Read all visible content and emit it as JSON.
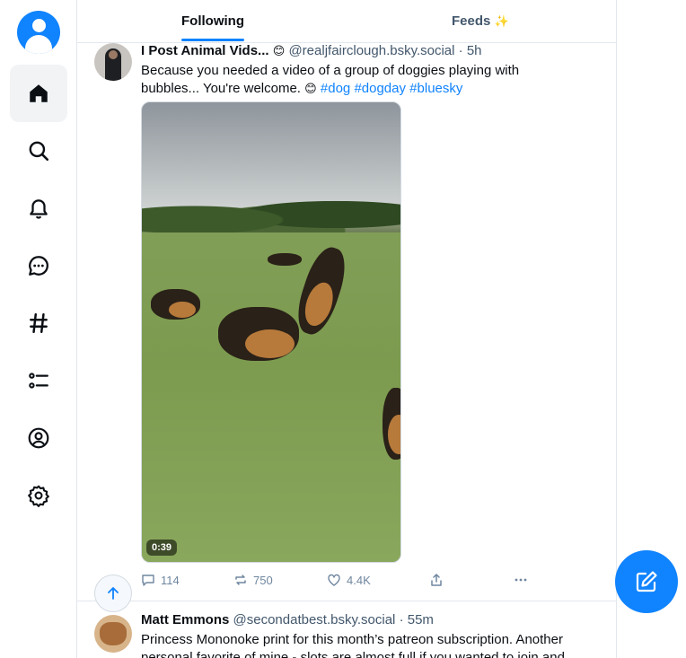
{
  "colors": {
    "accent": "#1083fe",
    "text": "#0b0f14",
    "muted": "#42576c",
    "border": "#e2e7ee"
  },
  "nav": {
    "items": [
      {
        "icon": "home-icon",
        "active": true
      },
      {
        "icon": "search-icon"
      },
      {
        "icon": "bell-icon"
      },
      {
        "icon": "chat-icon"
      },
      {
        "icon": "hashtag-icon"
      },
      {
        "icon": "list-icon"
      },
      {
        "icon": "profile-icon"
      },
      {
        "icon": "gear-icon"
      }
    ]
  },
  "tabs": {
    "following": "Following",
    "feeds": "Feeds",
    "feeds_emoji": "✨"
  },
  "posts": [
    {
      "author": "I Post Animal Vids...",
      "author_emoji": "😊",
      "handle": "@realjfairclough.bsky.social",
      "time": "· 5h",
      "text": "Because you needed a video of a group of doggies playing with bubbles... You're welcome.",
      "text_emoji": "😊",
      "tags": [
        "#dog",
        "#dogday",
        "#bluesky"
      ],
      "video_duration": "0:39",
      "replies": "114",
      "reposts": "750",
      "likes": "4.4K"
    },
    {
      "author": "Matt Emmons",
      "handle": "@secondatbest.bsky.social",
      "time": "· 55m",
      "text": "Princess Mononoke print for this month’s patreon subscription. Another personal favorite of mine - slots are almost full if you wanted to join and"
    }
  ]
}
